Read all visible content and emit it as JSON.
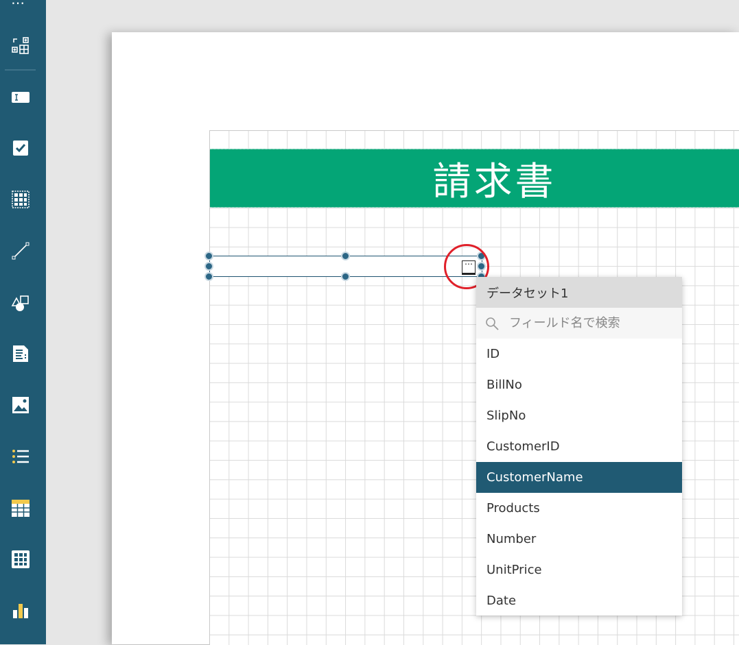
{
  "toolbar": {
    "top_glyph": "⋯",
    "tools": [
      {
        "name": "select-tool-icon"
      },
      {
        "name": "textbox-tool-icon"
      },
      {
        "name": "checkbox-tool-icon"
      },
      {
        "name": "grid-tool-icon"
      },
      {
        "name": "line-tool-icon"
      },
      {
        "name": "shape-tool-icon"
      },
      {
        "name": "document-tool-icon"
      },
      {
        "name": "image-tool-icon"
      },
      {
        "name": "list-tool-icon"
      },
      {
        "name": "table-tool-icon"
      },
      {
        "name": "tablix-tool-icon"
      },
      {
        "name": "chart-tool-icon"
      }
    ]
  },
  "report": {
    "title": "請求書"
  },
  "field_button": {
    "glyph": "⋯"
  },
  "dataset_dropdown": {
    "dataset_name": "データセット1",
    "search_placeholder": "フィールド名で検索",
    "fields": [
      "ID",
      "BillNo",
      "SlipNo",
      "CustomerID",
      "CustomerName",
      "Products",
      "Number",
      "UnitPrice",
      "Date"
    ],
    "selected_field": "CustomerName"
  },
  "colors": {
    "toolbar": "#205a73",
    "title_band": "#04a576",
    "selected_item": "#205a73",
    "highlight_circle": "#e0202a"
  }
}
